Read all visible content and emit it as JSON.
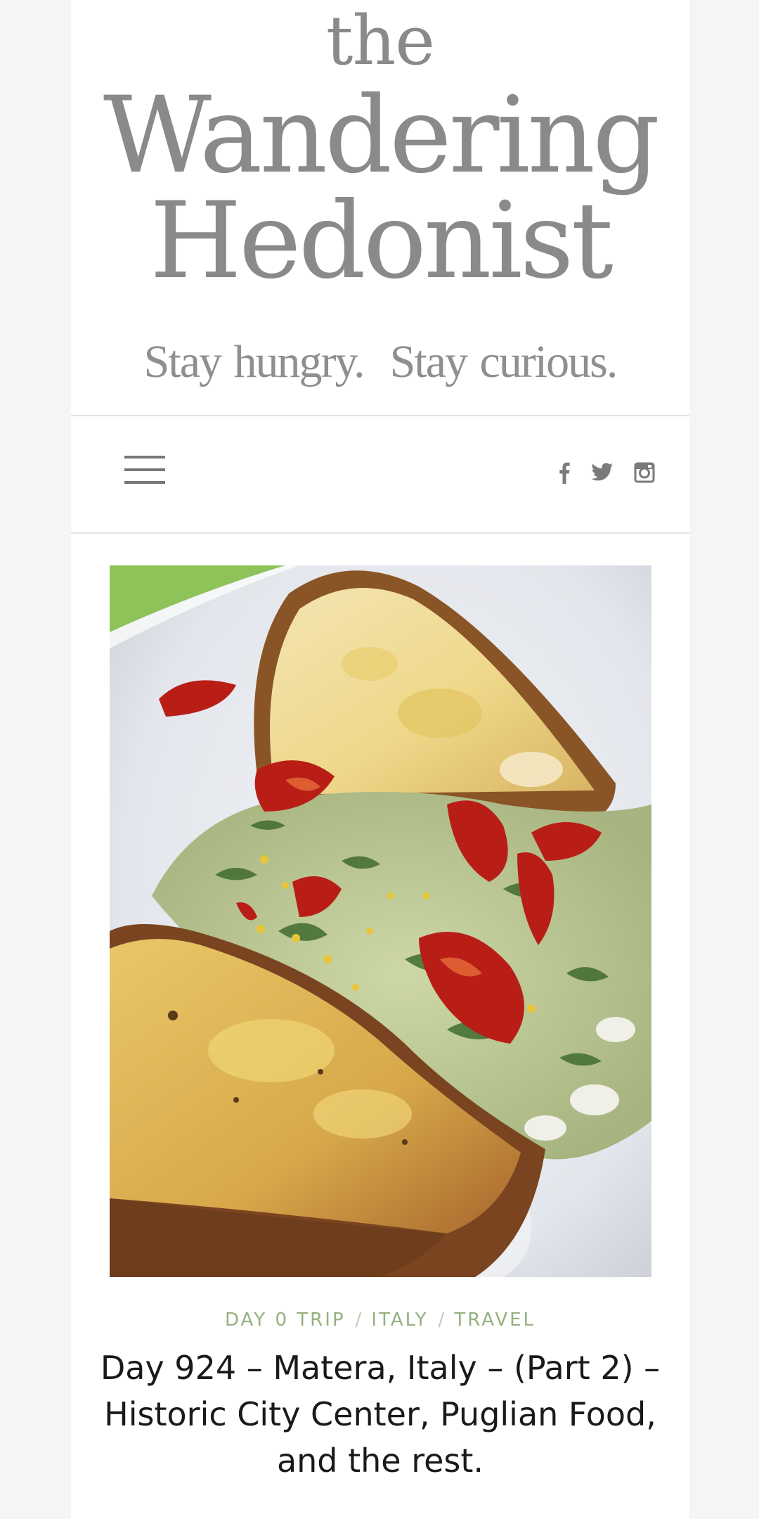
{
  "header": {
    "logo_the": "the",
    "logo_wandering": "Wandering",
    "logo_hedonist": "Hedonist",
    "tagline": "Stay hungry.  Stay curious."
  },
  "navbar": {
    "menu_icon": "hamburger-menu-icon",
    "social": [
      {
        "name": "facebook-icon"
      },
      {
        "name": "twitter-icon"
      },
      {
        "name": "instagram-icon"
      }
    ]
  },
  "post": {
    "image_subject": "toasted bread with creamy greens, beans and sun-dried tomatoes",
    "categories": [
      "DAY 0 TRIP",
      "ITALY",
      "TRAVEL"
    ],
    "separator": "/",
    "title": "Day 924 – Matera, Italy – (Part 2) – Historic City Center, Puglian Food, and the rest."
  },
  "colors": {
    "accent": "#95b07d",
    "logo_gray": "#8a8a8a",
    "background": "#f5f5f3"
  }
}
